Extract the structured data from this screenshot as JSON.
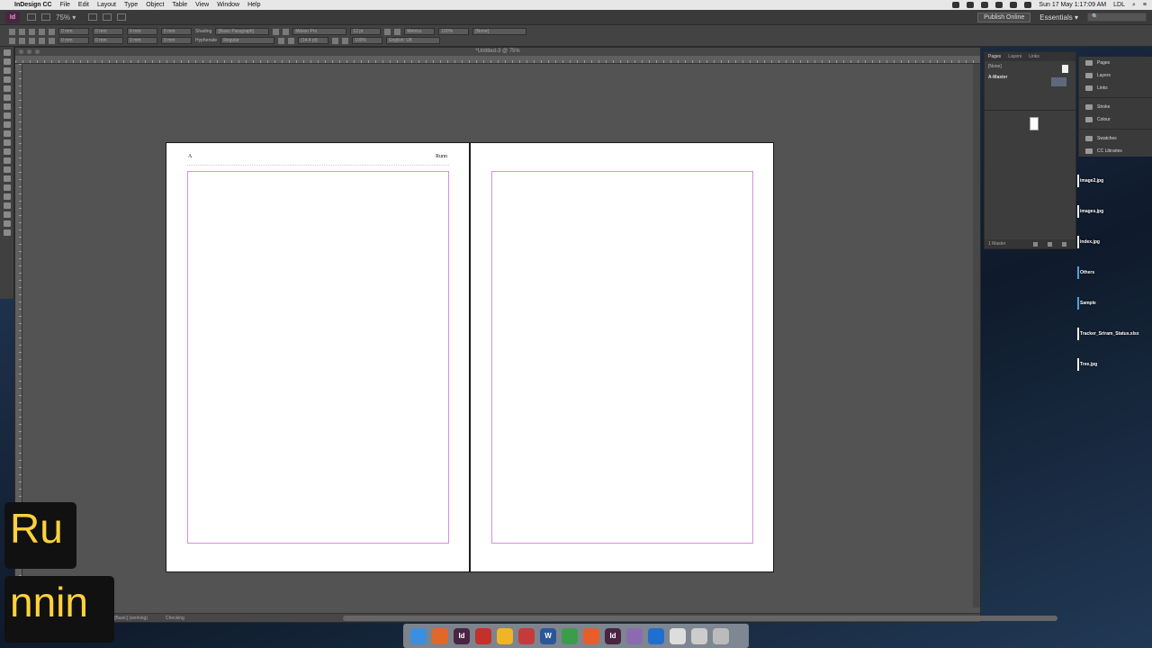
{
  "menubar": {
    "app_name": "InDesign CC",
    "items": [
      "File",
      "Edit",
      "Layout",
      "Type",
      "Object",
      "Table",
      "View",
      "Window",
      "Help"
    ],
    "clock": "Sun 17 May  1:17:09 AM",
    "user": "LDL"
  },
  "appbar": {
    "logo": "Id",
    "zoom": "75% ▾",
    "publish_label": "Publish Online",
    "workspace": "Essentials ▾",
    "stock_search_placeholder": "🔍"
  },
  "control": {
    "field_a": "0 mm",
    "field_b": "0 mm",
    "field_c": "0 mm",
    "field_d": "0 mm",
    "shading": "Shading",
    "hyphenate": "Hyphenate",
    "para_style": "[Basic Paragraph]",
    "font": "Minion Pro",
    "style": "Regular",
    "size": "12 pt",
    "leading": "(14.4 pt)",
    "tracking": "Metrics",
    "scale_h": "100%",
    "scale_v": "100%",
    "char_style": "[None]",
    "language": "English: UK"
  },
  "document": {
    "title": "*Untitled-3 @ 75%",
    "left_page": {
      "header_left": "A",
      "header_right": "Runn"
    },
    "status_style": "[Basic] (working)",
    "status_preflight": "Checking"
  },
  "pages_panel": {
    "tabs": [
      "Pages",
      "Layers",
      "Links"
    ],
    "none_label": "[None]",
    "master_label": "A-Master",
    "footer": "1 Master"
  },
  "dock": {
    "items": [
      {
        "label": "Pages",
        "icon": "pages-icon"
      },
      {
        "label": "Layers",
        "icon": "layers-icon"
      },
      {
        "label": "Links",
        "icon": "links-icon"
      },
      {
        "label": "Stroke",
        "icon": "stroke-icon"
      },
      {
        "label": "Colour",
        "icon": "colour-icon"
      },
      {
        "label": "Swatches",
        "icon": "swatches-icon"
      },
      {
        "label": "CC Libraries",
        "icon": "cc-libraries-icon"
      }
    ]
  },
  "desktop_files": [
    "image2.jpg",
    "images.jpg",
    "index.jpg",
    "Others",
    "Sample",
    "Tracker_Sriram_Status.xlsx",
    "Tree.jpg"
  ],
  "overlay": {
    "line1": "Ru",
    "line2": "nnin"
  },
  "colors": {
    "margin_guide": "#d98ed9",
    "app_bg": "#535353",
    "id_brand": "#4a2443"
  }
}
